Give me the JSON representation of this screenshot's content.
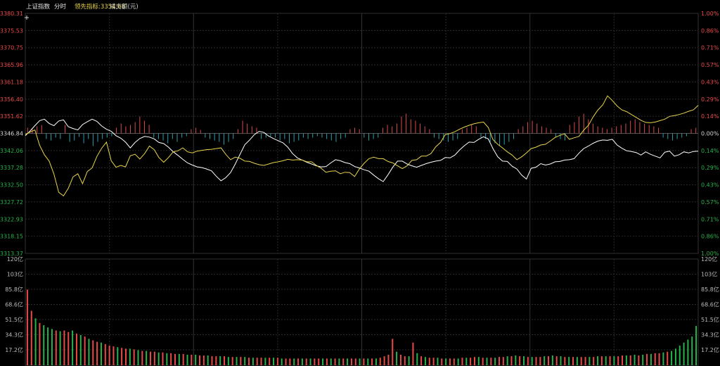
{
  "header": {
    "index_name": "上证指数",
    "tab": "分时",
    "leading_label": "领先指标:",
    "leading_value": "3354.68",
    "volume_label": "成交额(元)"
  },
  "colors": {
    "up": "#e84a4a",
    "down": "#28b24b",
    "neutral": "#d8d8d8",
    "index_line": "#ffffff",
    "leading_line": "#e8d44a",
    "up_bar": "#d94a4a",
    "down_bar": "#2a9fae",
    "grid": "#2a2a2a"
  },
  "chart_data": [
    {
      "type": "line",
      "price_ticks": [
        "3380.31",
        "3375.53",
        "3370.75",
        "3365.96",
        "3361.18",
        "3356.40",
        "3351.62",
        "3346.84",
        "3342.06",
        "3337.28",
        "3332.50",
        "3327.72",
        "3322.93",
        "3318.15",
        "3313.37"
      ],
      "pct_ticks": [
        "1.00%",
        "0.86%",
        "0.71%",
        "0.57%",
        "0.43%",
        "0.29%",
        "0.14%",
        "0.00%",
        "0.14%",
        "0.29%",
        "0.43%",
        "0.57%",
        "0.71%",
        "0.86%",
        "1.00%"
      ],
      "ylim": [
        3313.37,
        3380.31
      ],
      "prev_close": 3346.84,
      "grid": true,
      "series": [
        {
          "name": "上证指数",
          "values": [
            3346.2,
            3347.5,
            3349.0,
            3350.4,
            3350.8,
            3349.6,
            3349.0,
            3350.3,
            3350.6,
            3348.7,
            3348.2,
            3347.8,
            3349.3,
            3350.1,
            3350.8,
            3350.2,
            3348.9,
            3348.0,
            3347.4,
            3346.2,
            3345.5,
            3344.4,
            3342.8,
            3344.3,
            3345.4,
            3346.0,
            3345.8,
            3345.3,
            3344.3,
            3344.0,
            3343.0,
            3341.7,
            3340.7,
            3339.6,
            3338.6,
            3338.0,
            3337.5,
            3337.3,
            3336.9,
            3336.4,
            3334.9,
            3333.6,
            3334.5,
            3335.9,
            3338.3,
            3341.0,
            3343.7,
            3345.0,
            3346.5,
            3347.4,
            3347.1,
            3346.1,
            3345.4,
            3344.8,
            3344.2,
            3343.0,
            3341.2,
            3340.0,
            3339.4,
            3338.8,
            3338.3,
            3337.8,
            3337.5,
            3337.6,
            3338.6,
            3339.5,
            3339.2,
            3338.7,
            3338.4,
            3337.6,
            3337.2,
            3336.7,
            3336.3,
            3335.2,
            3334.2,
            3333.4,
            3335.3,
            3337.4,
            3339.1,
            3339.1,
            3338.3,
            3337.8,
            3337.4,
            3337.9,
            3338.4,
            3338.8,
            3339.1,
            3339.3,
            3340.1,
            3340.0,
            3340.8,
            3342.2,
            3343.4,
            3344.4,
            3344.3,
            3345.2,
            3345.9,
            3345.3,
            3342.6,
            3340.3,
            3339.1,
            3339.0,
            3337.7,
            3336.9,
            3335.2,
            3334.1,
            3337.1,
            3337.4,
            3338.4,
            3338.0,
            3338.3,
            3338.9,
            3339.0,
            3339.4,
            3339.5,
            3339.8,
            3341.3,
            3342.6,
            3343.3,
            3344.1,
            3344.7,
            3345.0,
            3344.9,
            3345.2,
            3343.6,
            3342.7,
            3342.0,
            3341.8,
            3341.5,
            3340.8,
            3341.7,
            3341.0,
            3340.5,
            3340.0,
            3341.6,
            3341.9,
            3340.5,
            3340.9,
            3341.7,
            3341.4,
            3341.8,
            3341.9
          ]
        },
        {
          "name": "领先指标",
          "values": [
            3346.5,
            3347.2,
            3347.8,
            3343.5,
            3340.9,
            3339.1,
            3335.5,
            3330.4,
            3329.4,
            3331.5,
            3334.7,
            3335.6,
            3332.8,
            3336.2,
            3337.2,
            3340.4,
            3342.7,
            3344.4,
            3339.2,
            3337.4,
            3337.9,
            3337.5,
            3340.6,
            3341.0,
            3339.7,
            3341.2,
            3343.3,
            3342.3,
            3340.1,
            3338.8,
            3340.1,
            3341.7,
            3342.0,
            3342.8,
            3341.7,
            3341.4,
            3341.9,
            3342.1,
            3342.3,
            3342.4,
            3342.6,
            3342.8,
            3341.0,
            3339.5,
            3340.2,
            3339.9,
            3339.1,
            3339.0,
            3338.5,
            3338.1,
            3337.9,
            3338.3,
            3338.7,
            3338.9,
            3339.2,
            3339.6,
            3339.4,
            3339.5,
            3339.4,
            3338.9,
            3338.9,
            3337.9,
            3337.1,
            3336.0,
            3336.3,
            3336.4,
            3335.6,
            3336.0,
            3335.9,
            3334.8,
            3336.9,
            3338.5,
            3339.8,
            3340.2,
            3339.8,
            3339.8,
            3339.0,
            3338.6,
            3337.8,
            3337.0,
            3337.8,
            3339.3,
            3339.5,
            3340.5,
            3340.5,
            3341.2,
            3343.1,
            3344.3,
            3346.5,
            3346.8,
            3347.3,
            3348.0,
            3348.6,
            3349.1,
            3349.5,
            3349.8,
            3350.0,
            3348.5,
            3345.1,
            3343.8,
            3342.8,
            3341.7,
            3340.8,
            3339.5,
            3340.3,
            3341.4,
            3342.6,
            3343.0,
            3343.6,
            3343.8,
            3344.7,
            3345.7,
            3346.3,
            3346.7,
            3345.2,
            3345.6,
            3346.0,
            3347.7,
            3349.1,
            3351.5,
            3353.4,
            3354.8,
            3357.3,
            3356.0,
            3354.5,
            3353.4,
            3352.9,
            3352.1,
            3351.3,
            3350.5,
            3349.9,
            3349.8,
            3350.0,
            3350.4,
            3350.8,
            3351.6,
            3351.8,
            3352.1,
            3352.5,
            3353.0,
            3353.4,
            3354.68
          ]
        }
      ],
      "bars": [
        8,
        6,
        10,
        12,
        -8,
        -10,
        -6,
        -8,
        12,
        -12,
        -10,
        -5,
        -14,
        -8,
        -18,
        -12,
        -8,
        -6,
        -4,
        8,
        14,
        10,
        12,
        16,
        24,
        18,
        12,
        -6,
        -8,
        -10,
        -14,
        -8,
        -12,
        -6,
        -4,
        6,
        8,
        5,
        -6,
        -8,
        -10,
        -12,
        -16,
        -12,
        -8,
        6,
        18,
        14,
        10,
        8,
        -8,
        -6,
        -4,
        -6,
        -10,
        -8,
        -14,
        -12,
        -10,
        -6,
        -8,
        -6,
        -4,
        -6,
        -8,
        -10,
        -12,
        -8,
        -6,
        6,
        8,
        6,
        -6,
        -10,
        -8,
        -6,
        8,
        12,
        10,
        14,
        24,
        28,
        20,
        18,
        14,
        10,
        6,
        -6,
        -8,
        -10,
        -12,
        -10,
        -8,
        6,
        8,
        12,
        10,
        -6,
        -8,
        -12,
        -14,
        -18,
        -16,
        -12,
        -8,
        6,
        10,
        16,
        18,
        14,
        10,
        8,
        6,
        -6,
        -8,
        -10,
        12,
        16,
        24,
        28,
        20,
        14,
        10,
        8,
        6,
        8,
        10,
        12,
        14,
        18,
        20,
        16,
        14,
        12,
        10,
        8,
        -6,
        -8,
        -10,
        -8,
        -6,
        -4,
        6,
        8
      ]
    },
    {
      "type": "bar",
      "title": "成交额(元)",
      "ticks": [
        "120亿",
        "103亿",
        "85.8亿",
        "68.6亿",
        "51.5亿",
        "34.3亿",
        "17.2亿"
      ],
      "ylim": [
        0,
        120
      ],
      "values": [
        100,
        72,
        62,
        56,
        53,
        50,
        48,
        46,
        45,
        46,
        44,
        46,
        42,
        40,
        38,
        35,
        33,
        31,
        30,
        28,
        26,
        25,
        24,
        23,
        22,
        22,
        21,
        20,
        19,
        19,
        18,
        18,
        17,
        17,
        16,
        16,
        15,
        15,
        15,
        14,
        14,
        14,
        13,
        13,
        13,
        12,
        12,
        12,
        12,
        11,
        11,
        11,
        11,
        11,
        10,
        10,
        10,
        10,
        10,
        10,
        10,
        10,
        9,
        9,
        9,
        9,
        9,
        9,
        9,
        9,
        9,
        9,
        9,
        9,
        9,
        9,
        9,
        9,
        9,
        9,
        9,
        9,
        9,
        9,
        9,
        9,
        10,
        12,
        14,
        35,
        18,
        14,
        12,
        12,
        30,
        16,
        12,
        11,
        10,
        10,
        10,
        9,
        9,
        9,
        9,
        9,
        10,
        10,
        10,
        11,
        11,
        10,
        10,
        10,
        10,
        11,
        11,
        12,
        12,
        13,
        12,
        12,
        11,
        11,
        11,
        11,
        12,
        12,
        13,
        12,
        12,
        11,
        11,
        11,
        11,
        11,
        11,
        11,
        11,
        12,
        12,
        12,
        12,
        12,
        12,
        13,
        13,
        13,
        14,
        13,
        14,
        15,
        15,
        16,
        16,
        17,
        18,
        19,
        22,
        26,
        30,
        34,
        38,
        52
      ],
      "value_colors": [
        "up",
        "up",
        "down",
        "up",
        "down",
        "down",
        "down",
        "up",
        "down",
        "up",
        "up",
        "down",
        "up",
        "down",
        "up",
        "down",
        "up",
        "up",
        "down",
        "up",
        "up",
        "up",
        "down",
        "up",
        "up",
        "down",
        "up",
        "down",
        "up",
        "down",
        "up",
        "up",
        "down",
        "up",
        "down",
        "up",
        "up",
        "down",
        "up",
        "down",
        "up",
        "down",
        "up",
        "up",
        "down",
        "up",
        "up",
        "down",
        "up",
        "down",
        "up",
        "down",
        "up",
        "down",
        "up",
        "down",
        "up",
        "up",
        "down",
        "up",
        "down",
        "up",
        "down",
        "up",
        "up",
        "down",
        "up",
        "down",
        "up",
        "down",
        "up",
        "up",
        "down",
        "up",
        "down",
        "up",
        "down",
        "up",
        "down",
        "up",
        "up",
        "down",
        "up",
        "down",
        "up",
        "down",
        "up",
        "up",
        "up",
        "up",
        "down",
        "up",
        "up",
        "down",
        "up",
        "down",
        "up",
        "down",
        "up",
        "up",
        "down",
        "up",
        "down",
        "up",
        "up",
        "down",
        "up",
        "down",
        "up",
        "up",
        "down",
        "up",
        "down",
        "up",
        "down",
        "up",
        "up",
        "down",
        "up",
        "down",
        "up",
        "down",
        "up",
        "down",
        "up",
        "up",
        "down",
        "up",
        "down",
        "up",
        "down",
        "up",
        "down",
        "up",
        "down",
        "up",
        "up",
        "down",
        "up",
        "down",
        "up",
        "down",
        "up",
        "down",
        "up",
        "up",
        "down",
        "up",
        "down",
        "up",
        "down",
        "up",
        "down",
        "up",
        "up",
        "down",
        "up",
        "down",
        "down"
      ]
    }
  ]
}
